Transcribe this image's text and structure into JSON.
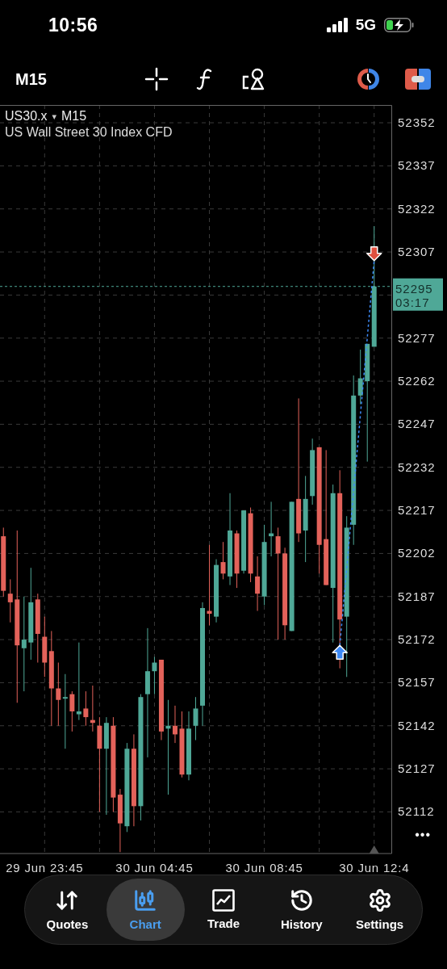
{
  "status_bar": {
    "time": "10:56",
    "network": "5G"
  },
  "toolbar": {
    "timeframe": "M15"
  },
  "chart": {
    "symbol": "US30.x",
    "caret": "▾",
    "period": "M15",
    "description": "US Wall Street 30 Index CFD",
    "chart_data": {
      "type": "candlestick",
      "grid": true,
      "ylim": [
        52097.5,
        52358.2
      ],
      "yticks": [
        52352,
        52337,
        52322,
        52307,
        52277,
        52262,
        52247,
        52232,
        52217,
        52202,
        52187,
        52172,
        52157,
        52142,
        52127,
        52112
      ],
      "categories": [
        null,
        null,
        null,
        null,
        null,
        null,
        "29 Jun 23:45",
        null,
        null,
        null,
        null,
        null,
        null,
        null,
        null,
        null,
        null,
        null,
        null,
        null,
        null,
        null,
        "30 Jun 04:45",
        null,
        null,
        null,
        null,
        null,
        null,
        null,
        null,
        null,
        null,
        null,
        null,
        null,
        null,
        null,
        "30 Jun 08:45",
        null,
        null,
        null,
        null,
        null,
        null,
        null,
        null,
        null,
        null,
        null,
        null,
        null,
        null,
        null,
        "30 Jun 12:4",
        null,
        null
      ],
      "ohlc": [
        [
          52208,
          52211,
          52187,
          52189
        ],
        [
          52188,
          52193,
          52178,
          52185
        ],
        [
          52186,
          52210,
          52150,
          52170
        ],
        [
          52169,
          52187,
          52154,
          52172
        ],
        [
          52171,
          52197,
          52165,
          52185
        ],
        [
          52186,
          52188,
          52164,
          52174
        ],
        [
          52173,
          52180,
          52159,
          52164
        ],
        [
          52168,
          52175,
          52142,
          52155
        ],
        [
          52155,
          52164,
          52142,
          52151
        ],
        [
          52152,
          52160,
          52134,
          52152
        ],
        [
          52153,
          52154,
          52140,
          52147
        ],
        [
          52146,
          52171,
          52144,
          52147
        ],
        [
          52148,
          52154,
          52142,
          52145
        ],
        [
          52144,
          52156,
          52140,
          52143
        ],
        [
          52142,
          52145,
          52112,
          52134
        ],
        [
          52134,
          52145,
          52111,
          52143
        ],
        [
          52142,
          52145,
          52112,
          52117
        ],
        [
          52118,
          52120,
          52098,
          52108
        ],
        [
          52107,
          52136,
          52105,
          52134
        ],
        [
          52134,
          52139,
          52107,
          52114
        ],
        [
          52114,
          52153,
          52109,
          52152
        ],
        [
          52153,
          52176,
          52131,
          52161
        ],
        [
          52161,
          52166,
          52153,
          52164
        ],
        [
          52165,
          52165,
          52137,
          52140
        ],
        [
          52141,
          52151,
          52118,
          52142
        ],
        [
          52142,
          52149,
          52136,
          52139
        ],
        [
          52141,
          52147,
          52124,
          52125
        ],
        [
          52125,
          52147,
          52123,
          52141
        ],
        [
          52142,
          52152,
          52137,
          52148
        ],
        [
          52149,
          52185,
          52142,
          52183
        ],
        [
          52182,
          52205,
          52177,
          52181
        ],
        [
          52180,
          52200,
          52178,
          52198
        ],
        [
          52199,
          52206,
          52193,
          52195
        ],
        [
          52194,
          52223,
          52191,
          52210
        ],
        [
          52209,
          52210,
          52190,
          52195
        ],
        [
          52196,
          52217,
          52195,
          52217
        ],
        [
          52216,
          52218,
          52192,
          52195
        ],
        [
          52194,
          52201,
          52182,
          52188
        ],
        [
          52187,
          52212,
          52184,
          52206
        ],
        [
          52208,
          52220,
          52201,
          52209
        ],
        [
          52208,
          52211,
          52172,
          52202
        ],
        [
          52202,
          52204,
          52172,
          52177
        ],
        [
          52175,
          52220,
          52175,
          52220
        ],
        [
          52221,
          52256,
          52206,
          52209
        ],
        [
          52210,
          52229,
          52199,
          52221
        ],
        [
          52222,
          52242,
          52219,
          52238
        ],
        [
          52239,
          52239,
          52195,
          52205
        ],
        [
          52207,
          52238,
          52191,
          52191
        ],
        [
          52190,
          52226,
          52171,
          52223
        ],
        [
          52223,
          52231,
          52162,
          52179
        ],
        [
          52180,
          52215,
          52159,
          52211
        ],
        [
          52212,
          52264,
          52205,
          52257
        ],
        [
          52257,
          52273,
          52254,
          52263
        ],
        [
          52262,
          52275,
          52234,
          52275
        ],
        [
          52274,
          52316,
          52274,
          52295
        ],
        null,
        null
      ]
    },
    "price_tag": {
      "price": "52295",
      "countdown": "03:17"
    },
    "more": "•••"
  },
  "nav": [
    {
      "label": "Quotes",
      "selected": false
    },
    {
      "label": "Chart",
      "selected": true
    },
    {
      "label": "Trade",
      "selected": false
    },
    {
      "label": "History",
      "selected": false
    },
    {
      "label": "Settings",
      "selected": false
    }
  ]
}
